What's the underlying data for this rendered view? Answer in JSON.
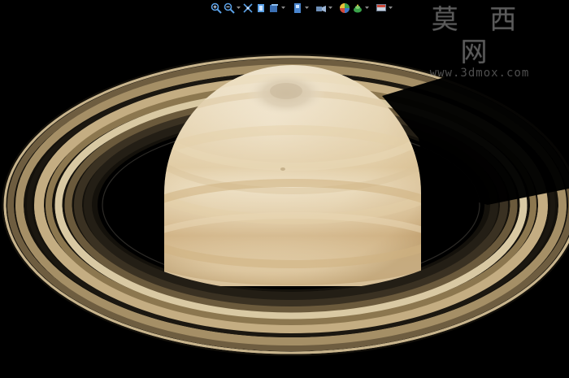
{
  "viewport": {
    "background": "#000000",
    "object": "saturn-model"
  },
  "toolbar": {
    "items": [
      {
        "icon": "zoom-in-icon",
        "type": "button"
      },
      {
        "icon": "zoom-out-icon",
        "type": "button"
      },
      {
        "icon": "pan-icon",
        "type": "button"
      },
      {
        "icon": "orbit-icon",
        "type": "button"
      },
      {
        "icon": "view-cube-icon",
        "type": "button"
      },
      {
        "icon": "window-view-icon",
        "type": "button"
      },
      {
        "icon": "walk-camera-icon",
        "type": "button"
      },
      {
        "icon": "material-sphere-icon",
        "type": "button"
      },
      {
        "icon": "render-teapot-icon",
        "type": "button"
      },
      {
        "icon": "display-settings-icon",
        "type": "button"
      }
    ]
  },
  "watermark": {
    "title": "莫 西 网",
    "url": "www.3dmox.com"
  },
  "colors": {
    "planet_light": "#f3e8d0",
    "planet_mid": "#e4cfa4",
    "planet_dark": "#c9ac7c",
    "ring_light": "#d8c8a2",
    "ring_mid": "#8a7552",
    "ring_dark": "#2f281c",
    "toolbar_icon": "#5aa0e6"
  }
}
